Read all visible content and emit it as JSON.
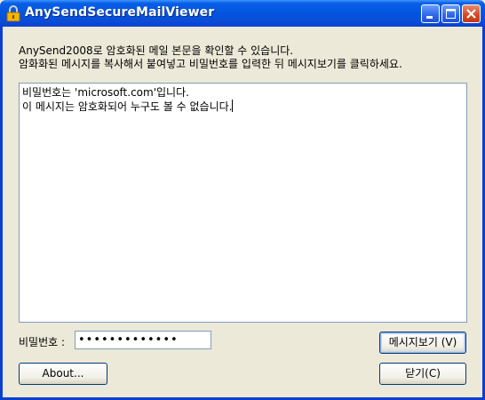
{
  "window": {
    "title": "AnySendSecureMailViewer"
  },
  "description": {
    "line1": "AnySend2008로 암호화된 메일 본문을 확인할 수 있습니다.",
    "line2": "암화화된 메시지를 복사해서 붙여넣고 비밀번호를 입력한 뒤 메시지보기를 클릭하세요."
  },
  "message": {
    "line1": "비밀번호는 'microsoft.com'입니다.",
    "line2": "이 메시지는 암호화되어 누구도 볼 수 없습니다."
  },
  "password": {
    "label": "비밀번호 :",
    "value": "•••••••••••••"
  },
  "buttons": {
    "view": "메시지보기 (V)",
    "about": "About...",
    "close": "닫기(C)"
  },
  "icons": {
    "app": "lock-icon",
    "minimize": "minimize-icon",
    "maximize": "maximize-icon",
    "close": "close-icon"
  }
}
